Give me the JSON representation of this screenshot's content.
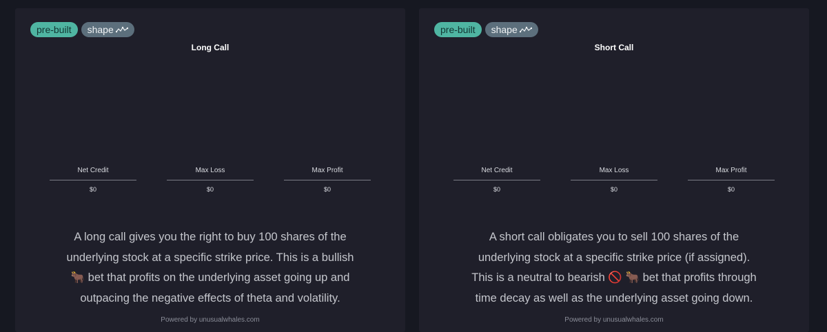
{
  "cards": [
    {
      "tags": {
        "prebuilt": "pre-built",
        "shape": "shape"
      },
      "title": "Long Call",
      "stats": [
        {
          "label": "Net Credit",
          "value": "$0"
        },
        {
          "label": "Max Loss",
          "value": "$0"
        },
        {
          "label": "Max Profit",
          "value": "$0"
        }
      ],
      "description": "A long call gives you the right to buy 100 shares of the underlying stock at a specific strike price. This is a bullish 🐂 bet that profits on the underlying asset going up and outpacing the negative effects of theta and volatility.",
      "powered_by": "Powered by unusualwhales.com"
    },
    {
      "tags": {
        "prebuilt": "pre-built",
        "shape": "shape"
      },
      "title": "Short Call",
      "stats": [
        {
          "label": "Net Credit",
          "value": "$0"
        },
        {
          "label": "Max Loss",
          "value": "$0"
        },
        {
          "label": "Max Profit",
          "value": "$0"
        }
      ],
      "description": "A short call obligates you to sell 100 shares of the underlying stock at a specific strike price (if assigned). This is a neutral to bearish 🚫 🐂 bet that profits through time decay as well as the underlying asset going down.",
      "powered_by": "Powered by unusualwhales.com"
    }
  ],
  "colors": {
    "background": "#161821",
    "card": "#1f1f2a",
    "prebuilt_tag": "#4fb5a2",
    "shape_tag": "#5c6f7c"
  },
  "icons": {
    "shape_tag_icon": "wave-line-icon"
  }
}
